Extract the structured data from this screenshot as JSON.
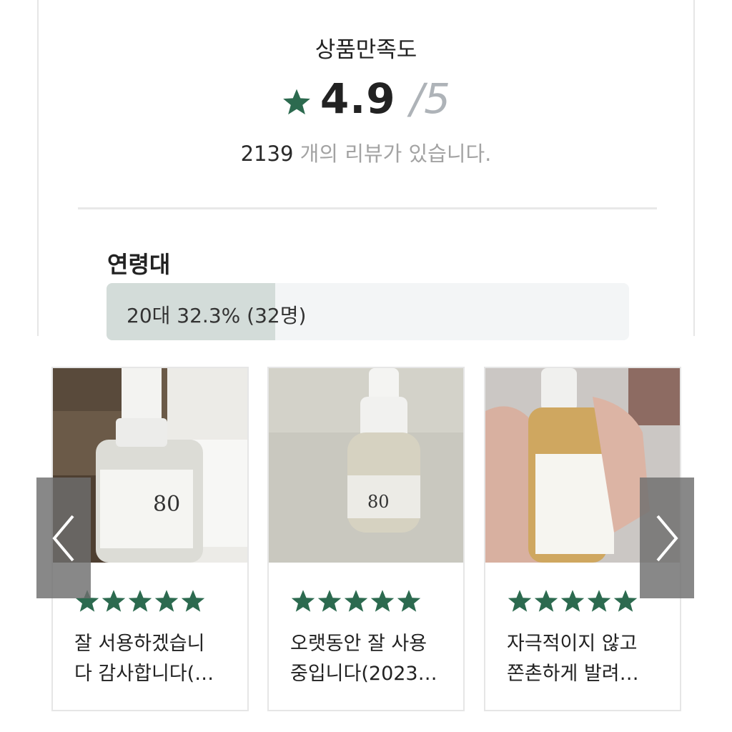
{
  "summary": {
    "title": "상품만족도",
    "score": "4.9",
    "score_max": "/5",
    "review_count": "2139",
    "review_count_text": " 개의 리뷰가 있습니다."
  },
  "age_group": {
    "title": "연령대",
    "top_label": "20대 32.3% (32명)",
    "top_percent": 32.3
  },
  "reviews": [
    {
      "rating": 5,
      "text": "잘 서용하겠습니\n다 감사합니다(…",
      "photo": "anua-ampoule-with-500ml-toner"
    },
    {
      "rating": 5,
      "text": "오랫동안 잘 사용\n중입니다(2023…",
      "photo": "anua-ampoule-on-desk"
    },
    {
      "rating": 5,
      "text": "자극적이지 않고\n쫀촌하게 발려…",
      "photo": "anua-ampoule-in-hand"
    }
  ],
  "nav": {
    "prev_icon": "chevron-left-icon",
    "next_icon": "chevron-right-icon"
  },
  "colors": {
    "accent_green": "#2c6a4f",
    "age_fill": "#d3dcd9",
    "muted_text": "#a3a3a3"
  }
}
